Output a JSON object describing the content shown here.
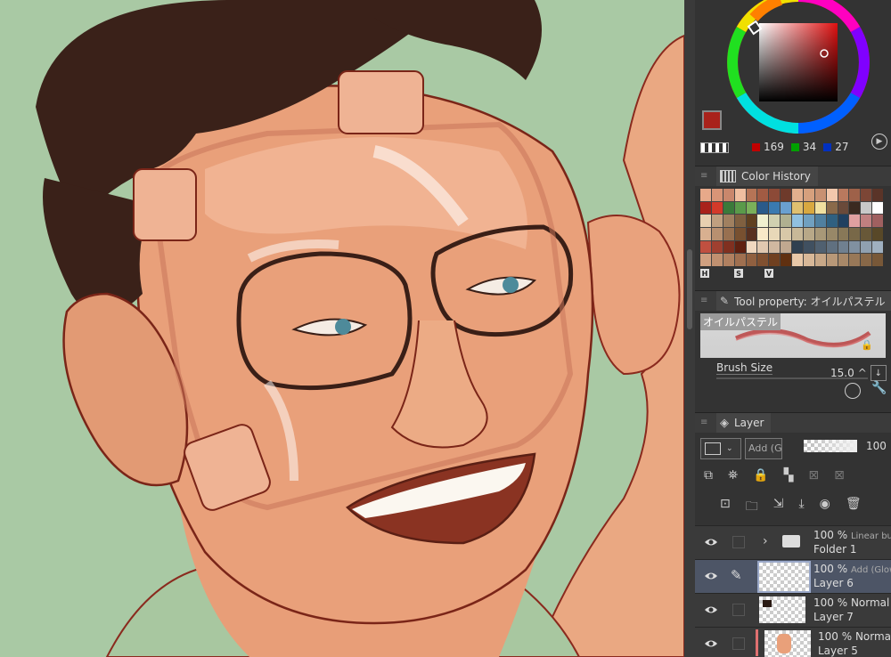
{
  "color_panel": {
    "red_value": "169",
    "green_value": "34",
    "blue_value": "27",
    "main_color": "#a9221b",
    "sub_color": "#ffffff"
  },
  "color_history": {
    "title": "Color History",
    "swatches": [
      "#e7a98a",
      "#d89577",
      "#c9876c",
      "#f0bfa0",
      "#b57456",
      "#a15b43",
      "#8c4a37",
      "#6e3a2b",
      "#e2b08e",
      "#d6a07d",
      "#c89172",
      "#f3c8ac",
      "#b9795e",
      "#9e6149",
      "#7c4636",
      "#5a3428",
      "#a9221b",
      "#d33a2a",
      "#3a7a3a",
      "#5a9a4a",
      "#7ab05a",
      "#2a5a8a",
      "#3a7ab0",
      "#6aa0d0",
      "#e0c070",
      "#d8a840",
      "#f0e0a0",
      "#8a6a4a",
      "#6a4a3a",
      "#3a2a20",
      "#c8c8c8",
      "#ffffff",
      "#e8d0b0",
      "#c0a080",
      "#a08060",
      "#806040",
      "#604020",
      "#f0f0d0",
      "#d0d0b0",
      "#b0b090",
      "#90c0e0",
      "#70a0c0",
      "#5080a0",
      "#306080",
      "#204060",
      "#e0a0a0",
      "#c08080",
      "#a06060",
      "#d8b090",
      "#b89070",
      "#987050",
      "#785030",
      "#583020",
      "#f8e8c8",
      "#e8d8b8",
      "#d8c8a8",
      "#c8b898",
      "#b8a888",
      "#a89878",
      "#988868",
      "#887858",
      "#786848",
      "#685838",
      "#584828",
      "#c05040",
      "#a04030",
      "#803020",
      "#602010",
      "#f0d8c0",
      "#e0c8b0",
      "#d0b8a0",
      "#c0a890",
      "#304050",
      "#405060",
      "#506070",
      "#607080",
      "#708090",
      "#8090a0",
      "#90a0b0",
      "#a0b0c0",
      "#d0a080",
      "#c09070",
      "#b08060",
      "#a07050",
      "#906040",
      "#805030",
      "#704020",
      "#603010",
      "#e8c8a8",
      "#d8b898",
      "#c8a888",
      "#b89878",
      "#a88868",
      "#987858",
      "#886848",
      "#785838"
    ],
    "hsv_labels": [
      "H",
      "S",
      "V"
    ]
  },
  "tool_property": {
    "title": "Tool property: オイルパステル",
    "brush_name": "オイルパステル",
    "brush_size_label": "Brush Size",
    "brush_size_value": "15.0"
  },
  "layer_panel": {
    "title": "Layer",
    "blend_mode": "Add (Glow)",
    "opacity": "100",
    "layers": [
      {
        "line1": "100 % ",
        "line1b": "Linear burn",
        "line2": "Folder 1"
      },
      {
        "line1": "100 % ",
        "line1b": "Add (Glow)",
        "line2": "Layer 6"
      },
      {
        "line1": "100 % ",
        "line1b": "Normal",
        "line2": "Layer 7"
      },
      {
        "line1": "100 % ",
        "line1b": "Normal",
        "line2": "Layer 5"
      }
    ]
  }
}
